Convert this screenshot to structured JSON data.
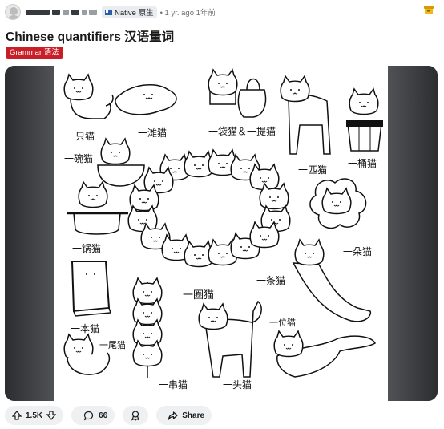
{
  "header": {
    "flair_text": "Native 原生",
    "meta_text": "• 1 yr. ago 1年前",
    "save_icon": "bookmark-icon"
  },
  "post": {
    "title": "Chinese quantifiers  汉语量词",
    "tag": "Grammar  语法"
  },
  "illustration": {
    "labels": {
      "zhi": "一只猫",
      "tan": "一滩猫",
      "dai_ti": "一袋猫＆一提猫",
      "wan": "一碗猫",
      "pi": "一匹猫",
      "tong": "一桶猫",
      "guo": "一锅猫",
      "duo": "一朵猫",
      "quan": "一圈猫",
      "tiao": "一条猫",
      "ben": "一本猫",
      "wei_fish": "一尾猫",
      "wei_person": "一位猫",
      "chuan": "一串猫",
      "tou": "一头猫"
    }
  },
  "actions": {
    "upvote_icon": "upvote-arrow-icon",
    "vote_count": "1.5K",
    "downvote_icon": "downvote-arrow-icon",
    "comment_icon": "comment-bubble-icon",
    "comment_count": "66",
    "award_icon": "award-icon",
    "share_icon": "share-arrow-icon",
    "share_label": "Share"
  },
  "colors": {
    "tag_bg": "#c81e28",
    "save_icon": "#d99a00",
    "pill_bg": "#eef0f2"
  }
}
